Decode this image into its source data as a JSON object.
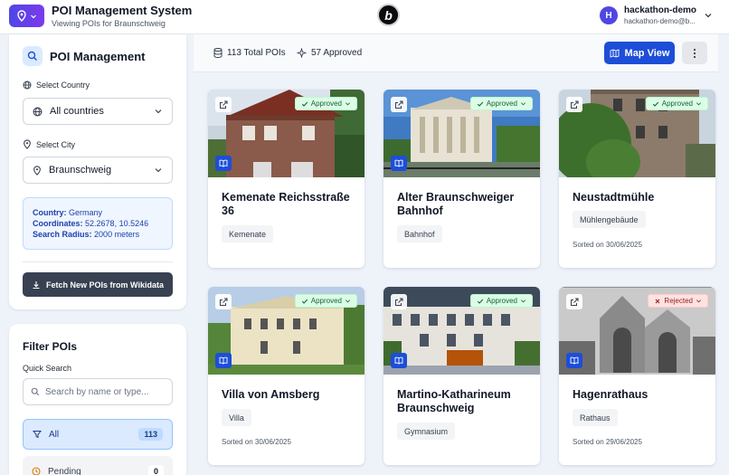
{
  "header": {
    "title": "POI Management System",
    "subtitle": "Viewing POIs for Braunschweig",
    "logo_letter": "b",
    "user_initial": "H",
    "user_name": "hackathon-demo",
    "user_email": "hackathon-demo@b..."
  },
  "poi_panel": {
    "title": "POI Management",
    "country_label": "Select Country",
    "country_value": "All countries",
    "city_label": "Select City",
    "city_value": "Braunschweig",
    "info": {
      "country_key": "Country:",
      "country_val": "Germany",
      "coords_key": "Coordinates:",
      "coords_val": "52.2678, 10.5246",
      "radius_key": "Search Radius:",
      "radius_val": "2000 meters"
    },
    "fetch_label": "Fetch New POIs from Wikidata"
  },
  "filter_panel": {
    "title": "Filter POIs",
    "quick_search_label": "Quick Search",
    "search_placeholder": "Search by name or type...",
    "options": [
      {
        "label": "All",
        "count": "113"
      },
      {
        "label": "Pending",
        "count": "0"
      }
    ]
  },
  "topbar": {
    "total": "113 Total POIs",
    "approved": "57 Approved",
    "map_view": "Map View"
  },
  "status_colors": {
    "approved": "#166534",
    "rejected": "#991b1b",
    "accent": "#1d4ed8"
  },
  "cards": [
    {
      "title": "Kemenate Reichsstraße 36",
      "status": "Approved",
      "tag": "Kemenate",
      "sorted": ""
    },
    {
      "title": "Alter Braunschweiger Bahnhof",
      "status": "Approved",
      "tag": "Bahnhof",
      "sorted": ""
    },
    {
      "title": "Neustadtmühle",
      "status": "Approved",
      "tag": "Mühlengebäude",
      "sorted": "Sorted on 30/06/2025"
    },
    {
      "title": "Villa von Amsberg",
      "status": "Approved",
      "tag": "Villa",
      "sorted": "Sorted on 30/06/2025"
    },
    {
      "title": "Martino-Katharineum Braunschweig",
      "status": "Approved",
      "tag": "Gymnasium",
      "sorted": ""
    },
    {
      "title": "Hagenrathaus",
      "status": "Rejected",
      "tag": "Rathaus",
      "sorted": "Sorted on 29/06/2025"
    }
  ]
}
